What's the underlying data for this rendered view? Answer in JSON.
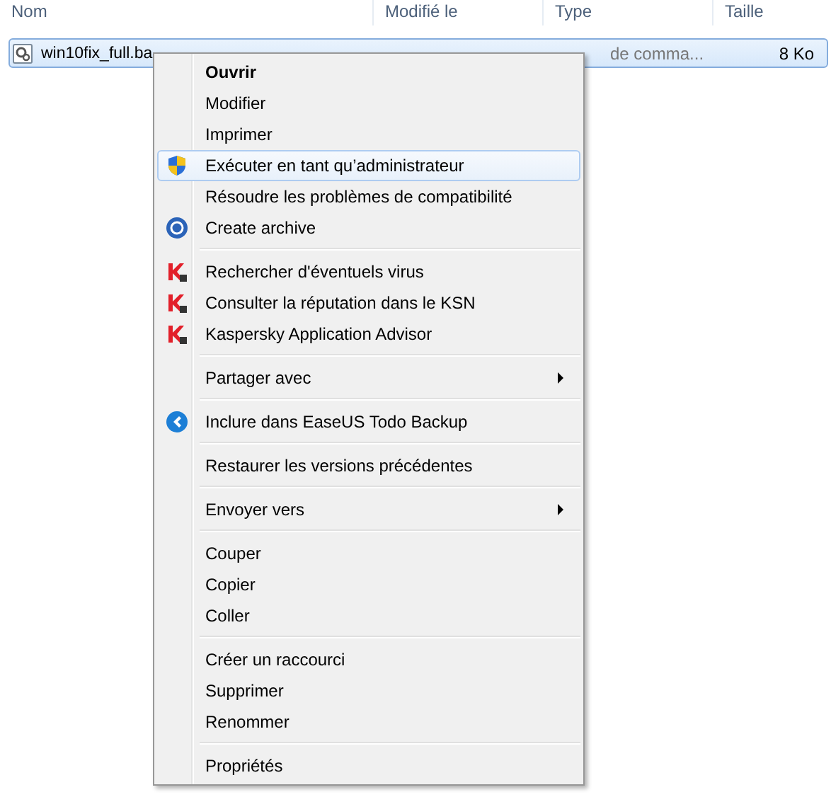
{
  "columns": [
    "Nom",
    "Modifié le",
    "Type",
    "Taille"
  ],
  "file": {
    "name": "win10fix_full.ba",
    "type": "de comma...",
    "size": "8 Ko",
    "selected": true
  },
  "menu": [
    [
      {
        "label": "Ouvrir",
        "default": true,
        "selected": false
      },
      {
        "label": "Modifier",
        "selected": false
      },
      {
        "label": "Imprimer",
        "selected": false
      },
      {
        "label": "Exécuter en tant qu’administrateur",
        "kind": "shield",
        "selected": true
      },
      {
        "label": "Résoudre les problèmes de compatibilité",
        "selected": false
      },
      {
        "label": "Create archive",
        "kind": "archiver",
        "selected": false
      }
    ],
    [
      {
        "label": "Rechercher d'éventuels virus",
        "kind": "antivirus",
        "selected": false
      },
      {
        "label": "Consulter la réputation dans le KSN",
        "kind": "antivirus",
        "selected": false
      },
      {
        "label": "Kaspersky Application Advisor",
        "kind": "antivirus",
        "selected": false
      }
    ],
    [
      {
        "label": "Partager avec",
        "submenu": true,
        "selected": false
      }
    ],
    [
      {
        "label": "Inclure dans EaseUS Todo Backup",
        "kind": "backup",
        "selected": false
      }
    ],
    [
      {
        "label": "Restaurer les versions précédentes",
        "selected": false
      }
    ],
    [
      {
        "label": "Envoyer vers",
        "submenu": true,
        "selected": false
      }
    ],
    [
      {
        "label": "Couper",
        "selected": false
      },
      {
        "label": "Copier",
        "selected": false
      },
      {
        "label": "Coller",
        "selected": false
      }
    ],
    [
      {
        "label": "Créer un raccourci",
        "selected": false
      },
      {
        "label": "Supprimer",
        "selected": false
      },
      {
        "label": "Renommer",
        "selected": false
      }
    ],
    [
      {
        "label": "Propriétés",
        "selected": false
      }
    ]
  ]
}
